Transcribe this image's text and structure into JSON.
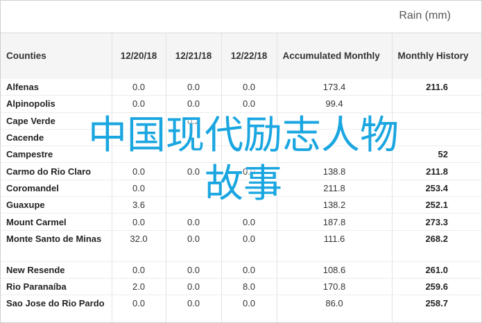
{
  "header": {
    "title": "Rain (mm)"
  },
  "table": {
    "columns": [
      "Counties",
      "12/20/18",
      "12/21/18",
      "12/22/18",
      "Accumulated Monthly",
      "Monthly History"
    ],
    "rows": [
      {
        "county": "Alfenas",
        "d1": "0.0",
        "d2": "0.0",
        "d3": "0.0",
        "acc": "173.4",
        "hist": "211.6"
      },
      {
        "county": "Alpinopolis",
        "d1": "0.0",
        "d2": "0.0",
        "d3": "0.0",
        "acc": "99.4",
        "hist": ""
      },
      {
        "county": "Cape Verde",
        "d1": "",
        "d2": "0.2",
        "d3": "",
        "acc": "",
        "hist": ""
      },
      {
        "county": "Cacende",
        "d1": "",
        "d2": "",
        "d3": "",
        "acc": "",
        "hist": ""
      },
      {
        "county": "Campestre",
        "d1": "",
        "d2": "",
        "d3": "",
        "acc": "",
        "hist": "52"
      },
      {
        "county": "Carmo do Rio Claro",
        "d1": "0.0",
        "d2": "0.0",
        "d3": "0.0",
        "acc": "138.8",
        "hist": "211.8"
      },
      {
        "county": "Coromandel",
        "d1": "0.0",
        "d2": "",
        "d3": "",
        "acc": "211.8",
        "hist": "253.4"
      },
      {
        "county": "Guaxupe",
        "d1": "3.6",
        "d2": "",
        "d3": "",
        "acc": "138.2",
        "hist": "252.1"
      },
      {
        "county": "Mount Carmel",
        "d1": "0.0",
        "d2": "0.0",
        "d3": "0.0",
        "acc": "187.8",
        "hist": "273.3"
      },
      {
        "county": "Monte Santo de Minas",
        "d1": "32.0",
        "d2": "0.0",
        "d3": "0.0",
        "acc": "111.6",
        "hist": "268.2"
      },
      {
        "county": "New Resende",
        "d1": "0.0",
        "d2": "0.0",
        "d3": "0.0",
        "acc": "108.6",
        "hist": "261.0"
      },
      {
        "county": "Rio Paranaíba",
        "d1": "2.0",
        "d2": "0.0",
        "d3": "8.0",
        "acc": "170.8",
        "hist": "259.6"
      },
      {
        "county": "Sao Jose do Rio Pardo",
        "d1": "0.0",
        "d2": "0.0",
        "d3": "0.0",
        "acc": "86.0",
        "hist": "258.7"
      }
    ]
  },
  "overlay": {
    "line1": "中国现代励志人物",
    "line2": "故事",
    "color": "#1aa6e0"
  }
}
